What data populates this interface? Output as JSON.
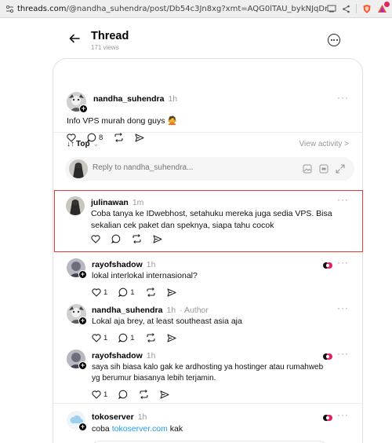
{
  "browser": {
    "url_prefix": "threads.com",
    "url_rest": "/@nandha_suhendra/post/Db54c3Jn8xg?xmt=AQG0lTAU_bykNJqDrYu2GecfaGkYdL..."
  },
  "header": {
    "title": "Thread",
    "views": "171 views"
  },
  "post": {
    "username": "nandha_suhendra",
    "time": "1h",
    "text": "Info VPS murah dong guys 🙅",
    "replies": "8"
  },
  "sort": {
    "label": "Top",
    "view_activity": "View activity >"
  },
  "reply_box": {
    "placeholder": "Reply to nandha_suhendra..."
  },
  "comments": [
    {
      "username": "julinawan",
      "time": "1m",
      "text": "Coba tanya ke IDwebhost, setahuku mereka juga sedia VPS. Bisa sekalian cek paket dan speknya, siapa tahu cocok",
      "likes": "",
      "replies": ""
    },
    {
      "username": "rayofshadow",
      "time": "1h",
      "text": "lokal interlokal internasional?",
      "likes": "1",
      "replies": "1"
    },
    {
      "username": "nandha_suhendra",
      "time": "1h",
      "meta": "· Author",
      "text": "Lokal aja brey, at least southeast asia aja",
      "likes": "1",
      "replies": "1"
    },
    {
      "username": "rayofshadow",
      "time": "1h",
      "text_line1": "saya sih biasa kalo gak ke ardhosting ya hostinger atau rumahweb",
      "text_line2": "yg berumur biasanya lebih terjamin.",
      "likes": "1",
      "replies": ""
    },
    {
      "username": "tokoserver",
      "time": "1h",
      "text_before": "coba ",
      "link": "tokoserver.com",
      "text_after": " kak"
    }
  ],
  "colors": {
    "highlight": "#e53935",
    "link": "#1d9bf0"
  }
}
